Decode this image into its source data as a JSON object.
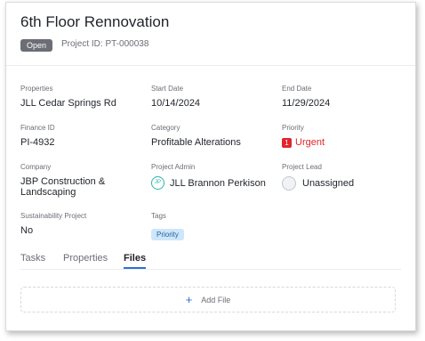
{
  "header": {
    "title": "6th Floor Rennovation",
    "status": "Open",
    "project_id": "Project ID: PT-000038"
  },
  "fields": {
    "properties": {
      "label": "Properties",
      "value": "JLL Cedar Springs Rd"
    },
    "start_date": {
      "label": "Start Date",
      "value": "10/14/2024"
    },
    "end_date": {
      "label": "End Date",
      "value": "11/29/2024"
    },
    "finance_id": {
      "label": "Finance ID",
      "value": "PI-4932"
    },
    "category": {
      "label": "Category",
      "value": "Profitable Alterations"
    },
    "priority": {
      "label": "Priority",
      "badge": "1",
      "value": "Urgent"
    },
    "company": {
      "label": "Company",
      "value": "JBP Construction & Landscaping"
    },
    "project_admin": {
      "label": "Project Admin",
      "initials": "JP",
      "value": "JLL Brannon Perkison"
    },
    "project_lead": {
      "label": "Project Lead",
      "value": "Unassigned"
    },
    "sustainability": {
      "label": "Sustainability Project",
      "value": "No"
    },
    "tags": {
      "label": "Tags",
      "items": [
        "Priority"
      ]
    }
  },
  "tabs": [
    {
      "label": "Tasks",
      "active": false
    },
    {
      "label": "Properties",
      "active": false
    },
    {
      "label": "Files",
      "active": true
    }
  ],
  "files": {
    "add_label": "Add File"
  },
  "colors": {
    "accent": "#2a6fdb",
    "urgent": "#e0262c",
    "tag_bg": "#cde6fb"
  }
}
